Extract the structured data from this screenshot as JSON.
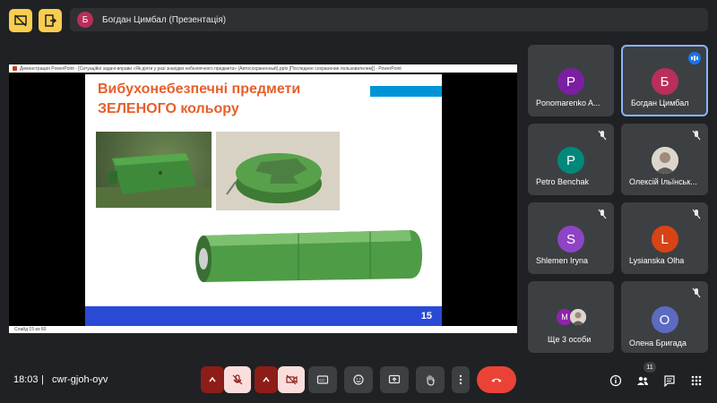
{
  "top": {
    "presenter_initial": "Б",
    "presenter_text": "Богдан Цимбал (Презентація)"
  },
  "presentation": {
    "window_title": "Демонстрация PowerPoint - [Ситуаційні задачі-вправи «Як діяти  у разі знахідки небезпечного предмета» (Автосохраненный).pptx [Последнее сохранение пользователем]] - PowerPoint",
    "slide_title_line1": "Вибухонебезпечні предмети",
    "slide_title_line2": "ЗЕЛЕНОГО кольору",
    "slide_number": "15",
    "status_text": "Слайд 15 из 60"
  },
  "participants": [
    {
      "initial": "P",
      "name": "Ponomarenko A...",
      "color": "#7b1fa2",
      "muted": false
    },
    {
      "initial": "Б",
      "name": "Богдан Цимбал",
      "color": "#b92e5a",
      "speaking": true
    },
    {
      "initial": "P",
      "name": "Petro Benchak",
      "color": "#00897b",
      "muted": true
    },
    {
      "initial": "",
      "name": "Олексій Ільїнськ...",
      "color": "#d7d2c8",
      "muted": true,
      "photo": true
    },
    {
      "initial": "S",
      "name": "Shlemen Iryna",
      "color": "#8e44c4",
      "muted": true
    },
    {
      "initial": "L",
      "name": "Lysianska Olha",
      "color": "#d84315",
      "muted": true
    },
    {
      "initial": "M",
      "name": "Ще 3 особи",
      "color": "#8e24aa",
      "muted": false
    },
    {
      "initial": "O",
      "name": "Олена Бригада",
      "color": "#5c6bc0",
      "muted": true
    }
  ],
  "bottom": {
    "time": "18:03",
    "separator": "|",
    "meeting_code": "cwr-gjoh-oyv",
    "people_count": "11"
  },
  "colors": {
    "background": "#202124",
    "tile": "#3c4043",
    "accent": "#8ab4f8",
    "end_call": "#ea4335",
    "top_buttons": "#f9ce4e"
  },
  "icons": [
    "present-off-icon",
    "exit-icon",
    "chevron-up-icon",
    "mic-off-icon",
    "camera-off-icon",
    "captions-icon",
    "emoji-icon",
    "present-icon",
    "raise-hand-icon",
    "more-icon",
    "end-call-icon",
    "info-icon",
    "people-icon",
    "chat-icon",
    "activities-icon"
  ]
}
